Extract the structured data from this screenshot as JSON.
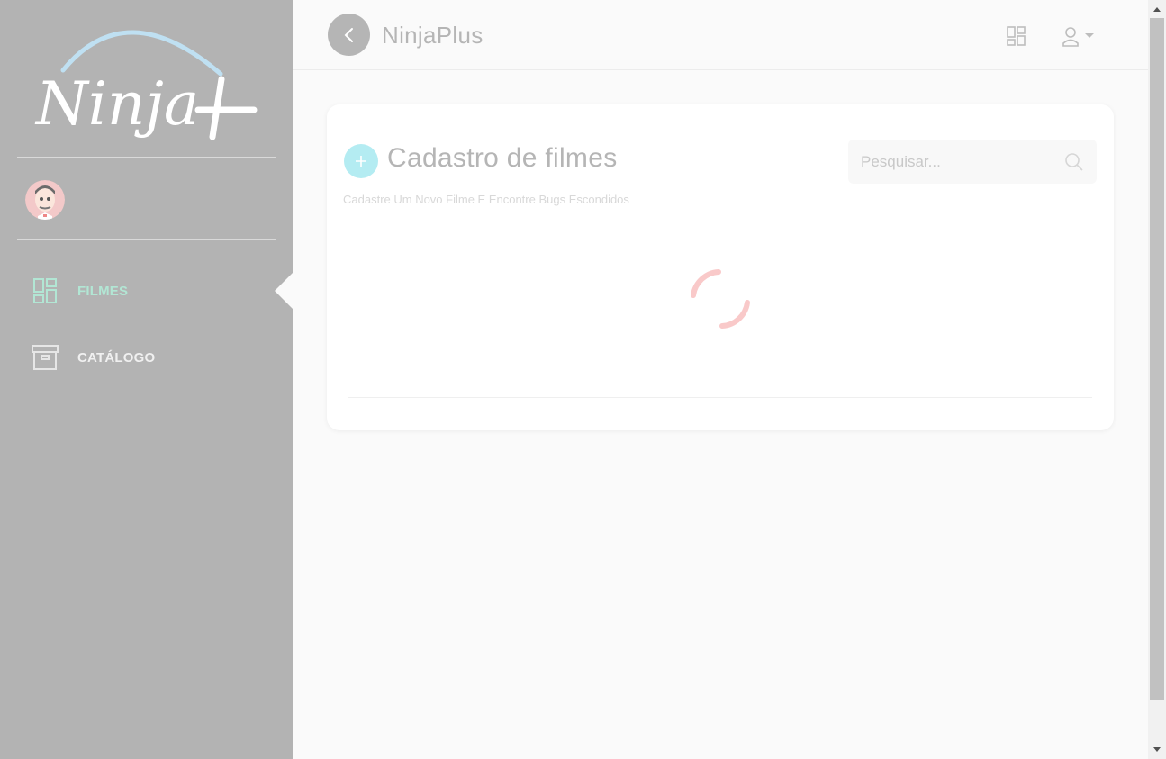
{
  "sidebar": {
    "logo_text": "Ninja+",
    "items": [
      {
        "label": "FILMES",
        "icon": "dashboard-grid-icon",
        "active": true
      },
      {
        "label": "CATÁLOGO",
        "icon": "archive-box-icon",
        "active": false
      }
    ]
  },
  "topbar": {
    "title": "NinjaPlus",
    "back_icon": "chevron-left-icon",
    "apps_icon": "grid-layout-icon",
    "user_icon": "user-icon"
  },
  "card": {
    "title": "Cadastro de filmes",
    "subtitle": "Cadastre Um Novo Filme E Encontre Bugs Escondidos",
    "search": {
      "placeholder": "Pesquisar..."
    },
    "add_icon": "plus-icon",
    "loading": true
  },
  "colors": {
    "sidebar_bg": "#b3b3b3",
    "active_nav": "#b2e6d4",
    "accent_cyan": "#b4ecf2",
    "spinner": "#f9c9c9"
  }
}
